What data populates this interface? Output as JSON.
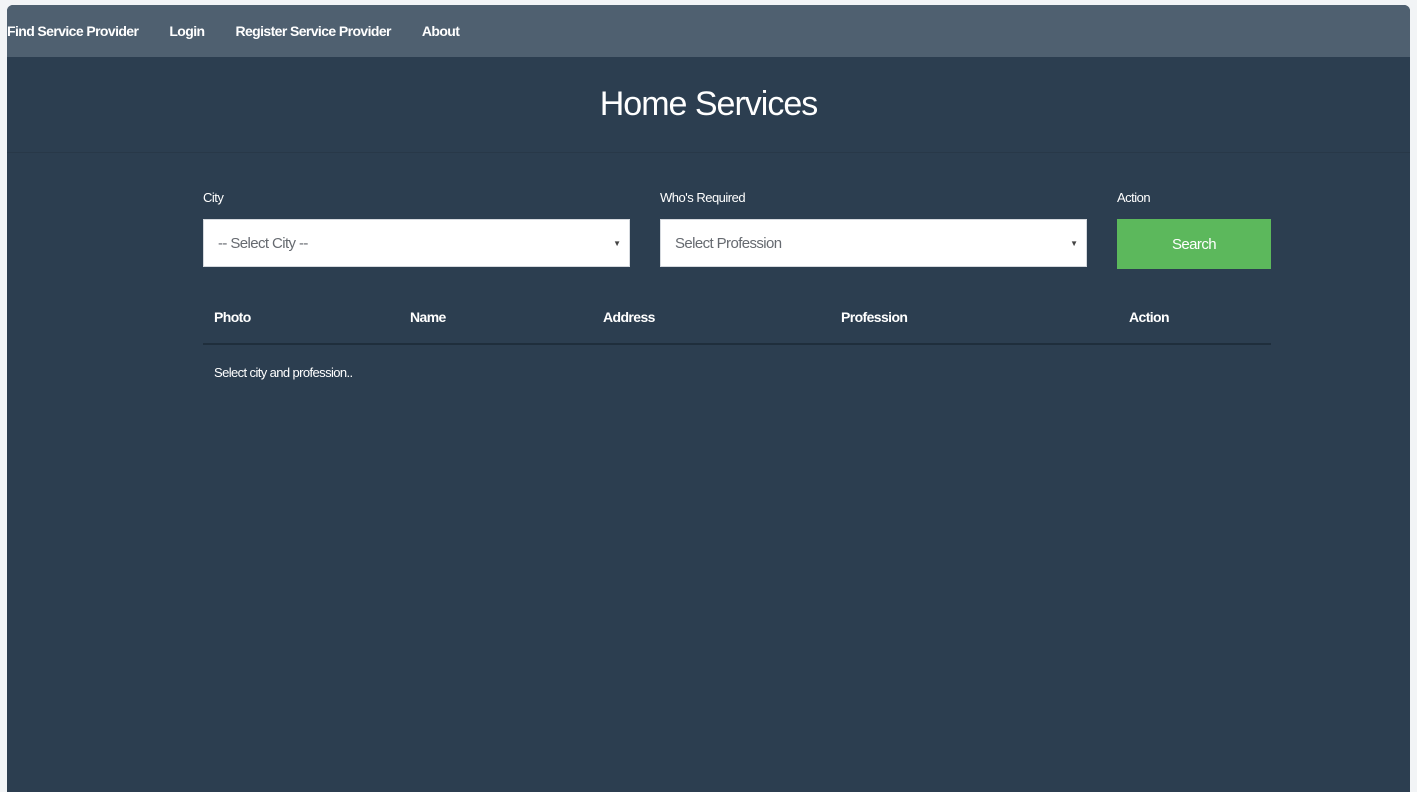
{
  "navbar": {
    "brand": "Find Service Provider",
    "links": [
      "Login",
      "Register Service Provider",
      "About"
    ]
  },
  "hero": {
    "title": "Home Services"
  },
  "form": {
    "city": {
      "label": "City",
      "selected": "-- Select City --"
    },
    "profession": {
      "label": "Who's Required",
      "selected": "Select Profession"
    },
    "action": {
      "label": "Action",
      "button": "Search"
    }
  },
  "table": {
    "headers": [
      "Photo",
      "Name",
      "Address",
      "Profession",
      "Action"
    ],
    "empty_message": "Select city and profession.."
  },
  "colors": {
    "background": "#2c3e50",
    "navbar": "#4f6070",
    "search_button": "#5cb85c"
  },
  "icons": {
    "select_arrow": "caret-down-icon"
  }
}
